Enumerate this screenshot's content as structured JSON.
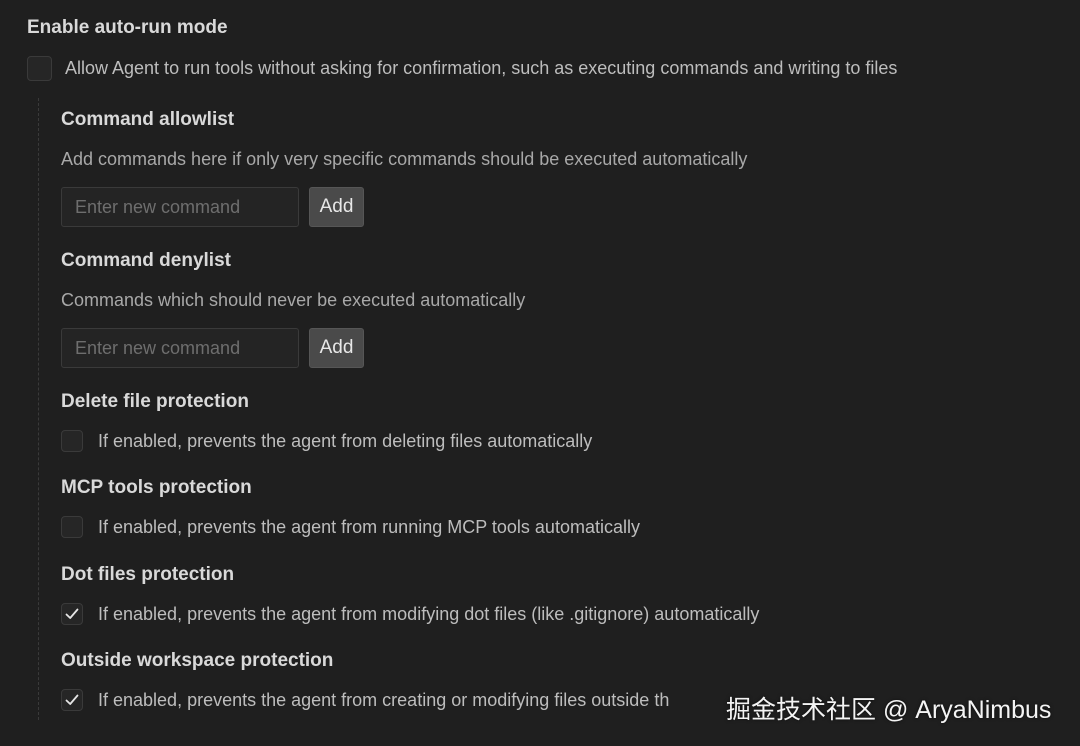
{
  "auto_run": {
    "title": "Enable auto-run mode",
    "checkbox_label": "Allow Agent to run tools without asking for confirmation, such as executing commands and writing to files",
    "checked": false
  },
  "allowlist": {
    "title": "Command allowlist",
    "description": "Add commands here if only very specific commands should be executed automatically",
    "placeholder": "Enter new command",
    "button_label": "Add"
  },
  "denylist": {
    "title": "Command denylist",
    "description": "Commands which should never be executed automatically",
    "placeholder": "Enter new command",
    "button_label": "Add"
  },
  "delete_file": {
    "title": "Delete file protection",
    "label": "If enabled, prevents the agent from deleting files automatically",
    "checked": false
  },
  "mcp_tools": {
    "title": "MCP tools protection",
    "label": "If enabled, prevents the agent from running MCP tools automatically",
    "checked": false
  },
  "dot_files": {
    "title": "Dot files protection",
    "label": "If enabled, prevents the agent from modifying dot files (like .gitignore) automatically",
    "checked": true
  },
  "outside_workspace": {
    "title": "Outside workspace protection",
    "label": "If enabled, prevents the agent from creating or modifying files outside th",
    "checked": true
  },
  "watermark": {
    "text": "掘金技术社区 @ AryaNimbus"
  },
  "colors": {
    "background": "#1f1f1f",
    "title_text": "#d9d9d9",
    "description_text": "#a8a8a8",
    "button_bg": "#4a4a4a"
  }
}
